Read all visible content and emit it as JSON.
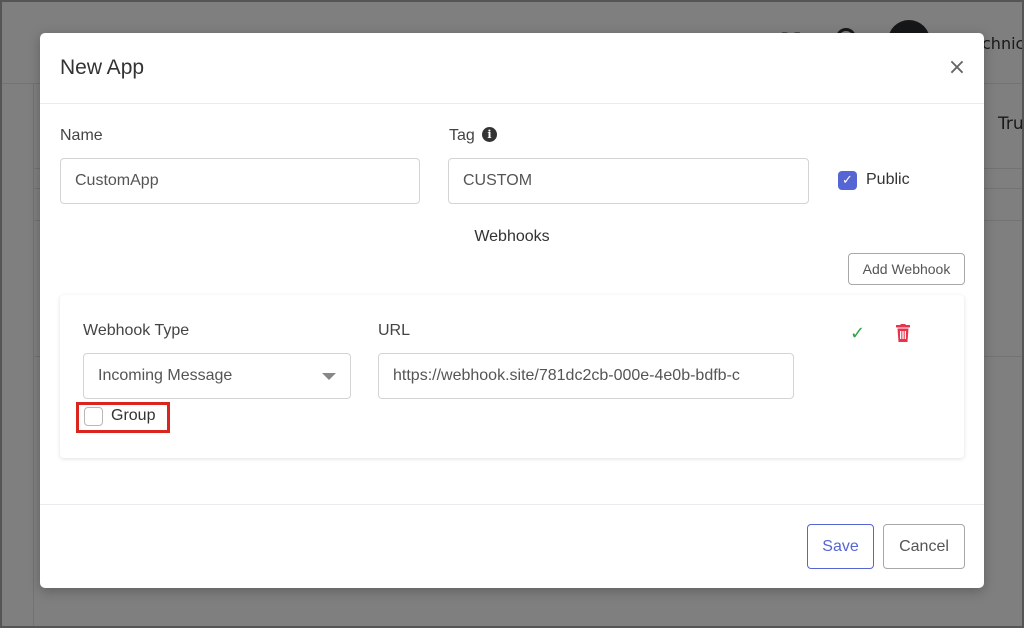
{
  "background": {
    "mail_icon_glyph": "M",
    "username_partial": "chnic",
    "column_header_partial": "Tru"
  },
  "modal": {
    "title": "New App",
    "close_glyph": "×"
  },
  "form": {
    "name_label": "Name",
    "name_value": "CustomApp",
    "tag_label": "Tag",
    "tag_value": "CUSTOM",
    "public_label": "Public",
    "public_checked": true
  },
  "webhooks": {
    "section_title": "Webhooks",
    "add_button_label": "Add Webhook",
    "items": [
      {
        "type_label": "Webhook Type",
        "type_value": "Incoming Message",
        "url_label": "URL",
        "url_value": "https://webhook.site/781dc2cb-000e-4e0b-bdfb-c",
        "group_label": "Group",
        "group_checked": false
      }
    ]
  },
  "footer": {
    "save_label": "Save",
    "cancel_label": "Cancel"
  },
  "colors": {
    "primary": "#5566d4",
    "success": "#28a745",
    "danger": "#e8334a",
    "highlight": "#d9251d"
  },
  "icons": {
    "info": "info-icon",
    "checkmark": "check-icon",
    "trash": "trash-icon",
    "close": "close-icon",
    "dropdown": "chevron-down-icon"
  }
}
